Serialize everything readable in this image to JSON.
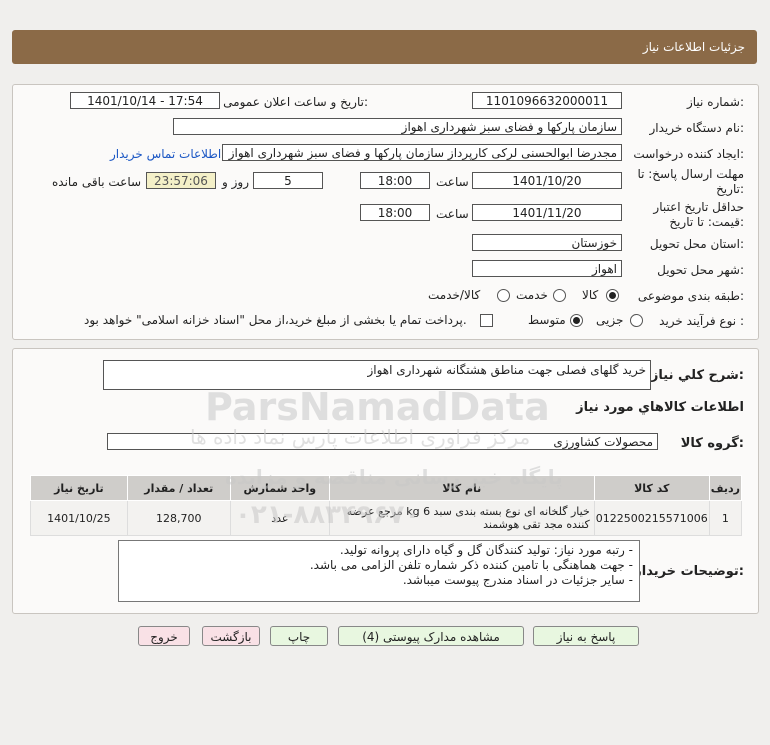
{
  "header": {
    "title": "جزئیات اطلاعات نیاز"
  },
  "form": {
    "need_number_label": "شماره نیاز:",
    "need_number": "1101096632000011",
    "announce_label": "تاریخ و ساعت اعلان عمومی:",
    "announce_value": "1401/10/14 - 17:54",
    "buyer_org_label": "نام دستگاه خریدار:",
    "buyer_org": "سازمان پارکها و فضای سبز شهرداری اهواز",
    "creator_label": "ایجاد کننده درخواست:",
    "creator": "مجدرضا ابوالحسنی لرکی کارپرداز سازمان پارکها و فضای سبز شهرداری اهواز",
    "contact_link": "اطلاعات تماس خریدار",
    "reply_deadline_label": "مهلت ارسال پاسخ: تا",
    "reply_deadline_label2": "تاریخ:",
    "reply_date": "1401/10/20",
    "time_label": "ساعت",
    "reply_time": "18:00",
    "days": "5",
    "days_label": "روز و",
    "remaining": "23:57:06",
    "remaining_label": "ساعت باقی مانده",
    "validity_label": "حداقل تاریخ اعتبار",
    "validity_label2": "قیمت: تا تاریخ:",
    "validity_date": "1401/11/20",
    "validity_time_label": "ساعت",
    "validity_time": "18:00",
    "province_label": "استان محل تحویل:",
    "province": "خوزستان",
    "city_label": "شهر محل تحویل:",
    "city": "اهواز",
    "category_label": "طبقه بندی موضوعی:",
    "cat_goods": "کالا",
    "cat_service": "خدمت",
    "cat_both": "کالا/خدمت",
    "process_label": "نوع فرآیند خرید :",
    "proc_partial": "جزیی",
    "proc_medium": "متوسط",
    "proc_note": "پرداخت تمام یا بخشی از مبلغ خرید،از محل \"اسناد خزانه اسلامی\" خواهد بود."
  },
  "details": {
    "summary_label": "شرح کلي نياز:",
    "summary": "خرید گلهای فصلی جهت مناطق هشتگانه شهرداری اهواز",
    "goods_info_title": "اطلاعات کالاهاي مورد نياز",
    "goods_group_label": "گروه کالا:",
    "goods_group": "محصولات کشاورزی",
    "table": {
      "headers": [
        "ردیف",
        "کد کالا",
        "نام کالا",
        "واحد شمارش",
        "تعداد / مقدار",
        "تاریخ نیاز"
      ],
      "rows": [
        [
          "1",
          "0122500215571006",
          "خیار گلخانه ای نوع بسته بندی سبد 6 kg مرجع عرضه کننده مجد تقی هوشمند",
          "عدد",
          "128,700",
          "1401/10/25"
        ]
      ]
    },
    "buyer_notes_label": "توضیحات خریدار:",
    "notes": [
      "- رتبه مورد نیاز: تولید کنندگان گل و گیاه دارای پروانه تولید.",
      "- جهت هماهنگی با تامین کننده ذکر شماره تلفن الزامی می باشد.",
      "- سایر جزئیات در اسناد مندرج پیوست میباشد."
    ]
  },
  "buttons": {
    "reply": "پاسخ به نیاز",
    "attachments": "مشاهده مدارک پیوستی (4)",
    "print": "چاپ",
    "back": "بازگشت",
    "exit": "خروج"
  },
  "watermark": {
    "brand": "ParsNamadData",
    "line1": "مرکز فراوری اطلاعات پارس نماد داده ها",
    "line2": "پایگاه خبر رسانی مناقصه و مزایده",
    "phone": "۰۲۱-۸۸۳۴۹۶۷۰"
  }
}
